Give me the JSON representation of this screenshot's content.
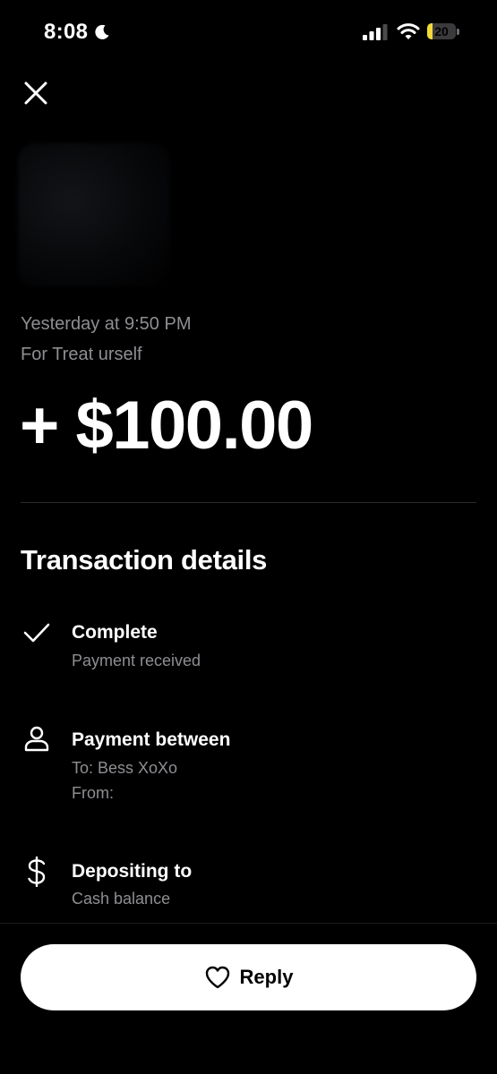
{
  "status_bar": {
    "time": "8:08",
    "battery_level": "20",
    "battery_fraction": 0.2,
    "icons": [
      "moon-icon",
      "signal-icon",
      "wifi-icon",
      "battery-icon"
    ]
  },
  "header": {
    "close_icon": "close-icon"
  },
  "transaction": {
    "date": "Yesterday at 9:50 PM",
    "note": "For Treat urself",
    "amount": "+ $100.00"
  },
  "details": {
    "title": "Transaction details",
    "status": {
      "icon": "checkmark-icon",
      "title": "Complete",
      "subtitle": "Payment received"
    },
    "between": {
      "icon": "person-icon",
      "title": "Payment between",
      "to": "To: Bess XoXo",
      "from": "From:"
    },
    "deposit": {
      "icon": "dollar-icon",
      "title": "Depositing to",
      "subtitle": "Cash balance"
    }
  },
  "actions": {
    "reply_label": "Reply",
    "reply_icon": "heart-icon"
  },
  "colors": {
    "background": "#000000",
    "text_primary": "#ffffff",
    "text_secondary": "#8e8e93",
    "button_background": "#ffffff",
    "battery_fill": "#f4d93b"
  }
}
